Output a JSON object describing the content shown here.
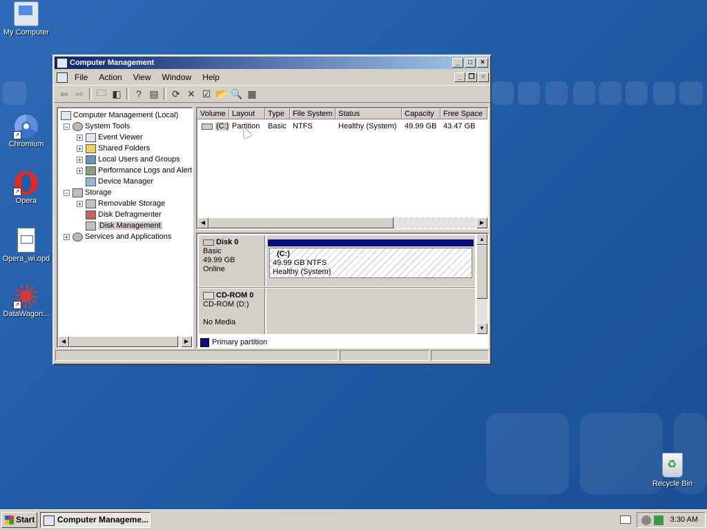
{
  "desktop": {
    "icons": [
      {
        "label": "My Computer",
        "icon": "my-computer-icon"
      },
      {
        "label": "Chromium",
        "icon": "chromium-icon"
      },
      {
        "label": "Opera",
        "icon": "opera-icon"
      },
      {
        "label": "Opera_wi.opd",
        "icon": "document-icon"
      },
      {
        "label": "DataWagon...",
        "icon": "datawagon-icon"
      },
      {
        "label": "Recycle Bin",
        "icon": "recycle-bin-icon"
      }
    ]
  },
  "window": {
    "title": "Computer Management",
    "menu": [
      "File",
      "Action",
      "View",
      "Window",
      "Help"
    ],
    "tree": [
      {
        "label": "Computer Management (Local)",
        "expander": "",
        "icon": "computer-icon"
      },
      {
        "label": "System Tools",
        "expander": "−",
        "icon": "gear-icon"
      },
      {
        "label": "Event Viewer",
        "expander": "+",
        "icon": "event-viewer-icon"
      },
      {
        "label": "Shared Folders",
        "expander": "+",
        "icon": "folder-icon"
      },
      {
        "label": "Local Users and Groups",
        "expander": "+",
        "icon": "users-icon"
      },
      {
        "label": "Performance Logs and Alerts",
        "expander": "+",
        "icon": "performance-icon"
      },
      {
        "label": "Device Manager",
        "expander": "",
        "icon": "device-manager-icon"
      },
      {
        "label": "Storage",
        "expander": "−",
        "icon": "storage-icon"
      },
      {
        "label": "Removable Storage",
        "expander": "+",
        "icon": "removable-storage-icon"
      },
      {
        "label": "Disk Defragmenter",
        "expander": "",
        "icon": "defrag-icon"
      },
      {
        "label": "Disk Management",
        "expander": "",
        "icon": "disk-management-icon"
      },
      {
        "label": "Services and Applications",
        "expander": "+",
        "icon": "services-icon"
      }
    ],
    "volume_columns": [
      "Volume",
      "Layout",
      "Type",
      "File System",
      "Status",
      "Capacity",
      "Free Space"
    ],
    "volume_rows": [
      {
        "volume": "(C:)",
        "layout": "Partition",
        "type": "Basic",
        "fs": "NTFS",
        "status": "Healthy (System)",
        "capacity": "49.99 GB",
        "free": "43.47 GB"
      }
    ],
    "disks": [
      {
        "name": "Disk 0",
        "type": "Basic",
        "size": "49.99 GB",
        "state": "Online",
        "partition": {
          "name": "(C:)",
          "detail": "49.99 GB NTFS",
          "status": "Healthy (System)"
        }
      },
      {
        "name": "CD-ROM 0",
        "type": "CD-ROM (D:)",
        "size": "",
        "state": "No Media"
      }
    ],
    "legend": "Primary partition",
    "colors": {
      "primary_partition": "#0a0a80",
      "titlebar_start": "#0a246a",
      "titlebar_end": "#a6caf0"
    }
  },
  "taskbar": {
    "start_label": "Start",
    "task_label": "Computer Manageme...",
    "clock": "3:30 AM"
  }
}
